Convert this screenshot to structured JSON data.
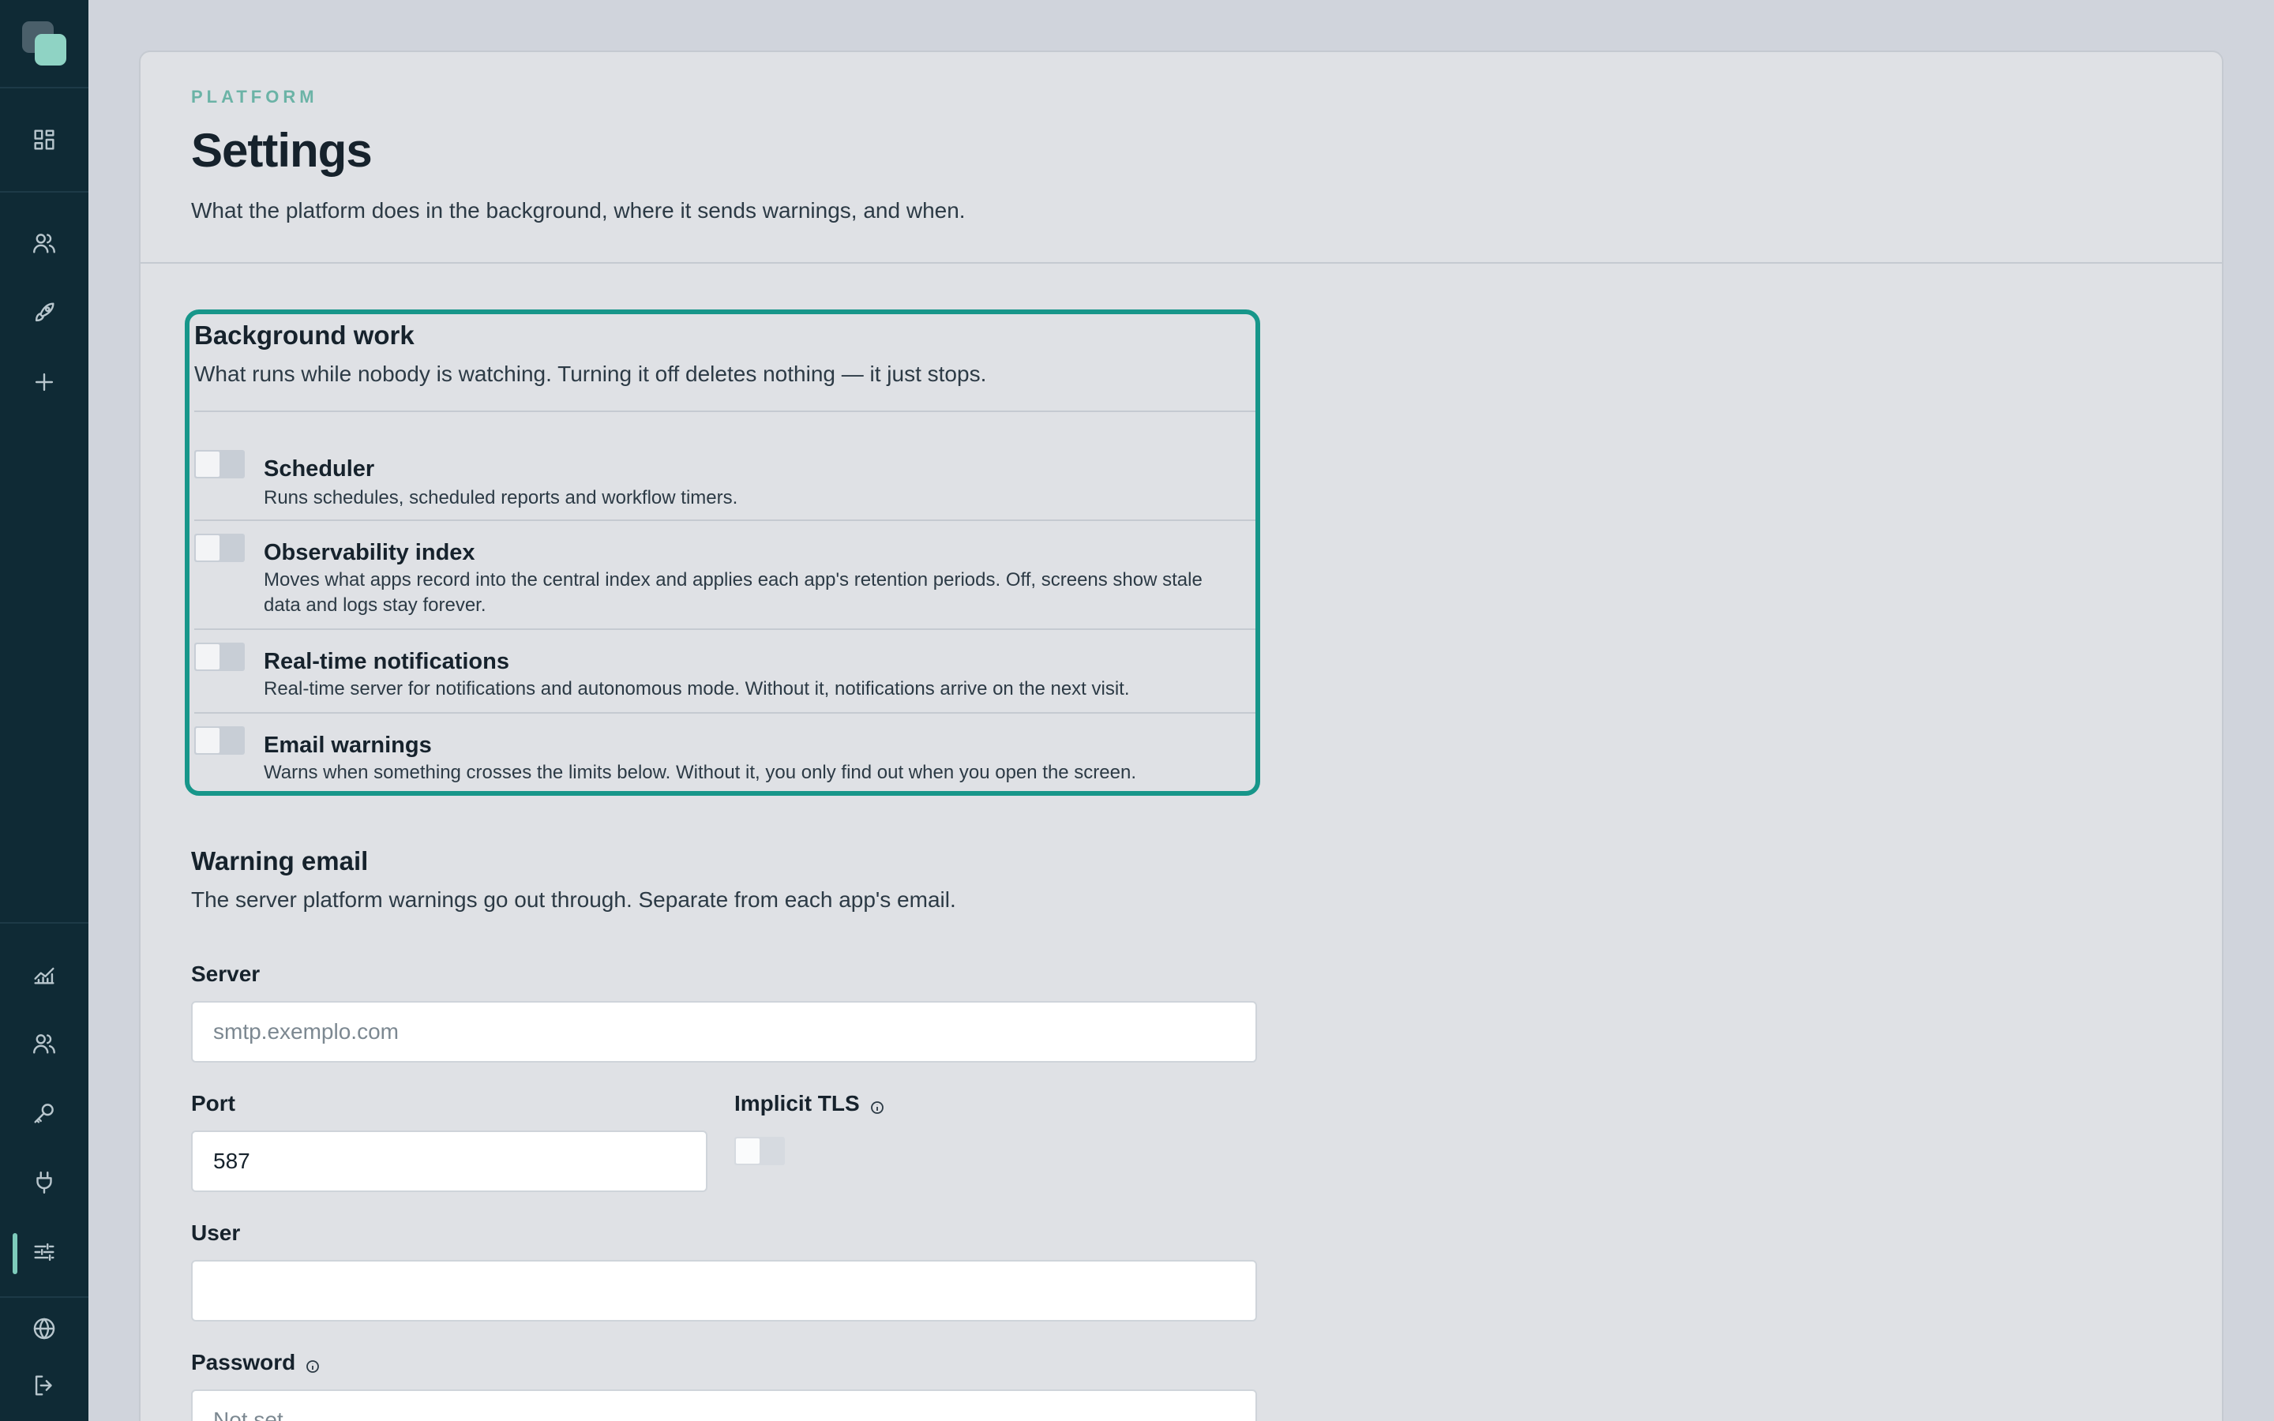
{
  "page": {
    "eyebrow": "PLATFORM",
    "title": "Settings",
    "subtitle": "What the platform does in the background, where it sends warnings, and when."
  },
  "sidebar": {
    "icons": [
      "grid-icon",
      "users-icon",
      "rocket-icon",
      "plus-icon",
      "chart-icon",
      "users-icon",
      "key-icon",
      "plug-icon",
      "sliders-icon",
      "globe-icon",
      "logout-icon"
    ],
    "active": "sliders-icon"
  },
  "background_work": {
    "title": "Background work",
    "description": "What runs while nobody is watching. Turning it off deletes nothing — it just stops.",
    "items": [
      {
        "title": "Scheduler",
        "description": "Runs schedules, scheduled reports and workflow timers.",
        "enabled": false
      },
      {
        "title": "Observability index",
        "description": "Moves what apps record into the central index and applies each app's retention periods. Off, screens show stale data and logs stay forever.",
        "enabled": false
      },
      {
        "title": "Real-time notifications",
        "description": "Real-time server for notifications and autonomous mode. Without it, notifications arrive on the next visit.",
        "enabled": false
      },
      {
        "title": "Email warnings",
        "description": "Warns when something crosses the limits below. Without it, you only find out when you open the screen.",
        "enabled": false
      }
    ]
  },
  "warning_email": {
    "title": "Warning email",
    "description": "The server platform warnings go out through. Separate from each app's email.",
    "server_label": "Server",
    "server_placeholder": "smtp.exemplo.com",
    "server_value": "",
    "port_label": "Port",
    "port_value": "587",
    "tls_label": "Implicit TLS",
    "tls_enabled": false,
    "user_label": "User",
    "user_value": "",
    "password_label": "Password",
    "password_placeholder": "Not set"
  },
  "colors": {
    "accent": "#17968a",
    "sidebar_bg": "#0f2a35",
    "card_bg": "#dfe1e5"
  }
}
